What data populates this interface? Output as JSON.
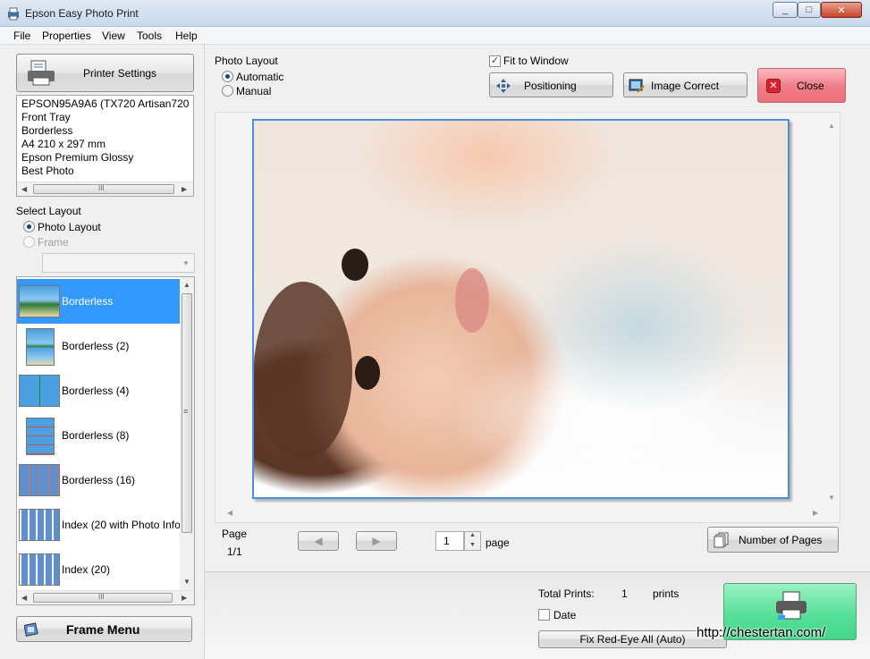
{
  "window": {
    "title": "Epson Easy Photo Print",
    "minimize": "_",
    "maximize": "□",
    "close": "✕"
  },
  "menu": [
    "File",
    "Properties",
    "View",
    "Tools",
    "Help"
  ],
  "printer": {
    "button_label": "Printer Settings",
    "info": [
      "EPSON95A9A6 (TX720 Artisan720",
      "Front Tray",
      "Borderless",
      "A4 210 x 297 mm",
      "Epson Premium Glossy",
      "Best Photo"
    ],
    "scroll_grip": "III"
  },
  "select_layout": {
    "heading": "Select Layout",
    "options": [
      "Photo Layout",
      "Frame"
    ],
    "selected": "Photo Layout",
    "items": [
      "Borderless",
      "Borderless (2)",
      "Borderless (4)",
      "Borderless (8)",
      "Borderless (16)",
      "Index (20 with Photo Info",
      "Index (20)"
    ],
    "selected_item": "Borderless",
    "scroll_grip_v": "≡",
    "scroll_grip_h": "III"
  },
  "frame_menu": {
    "label": "Frame Menu"
  },
  "photo_layout": {
    "heading": "Photo Layout",
    "options": [
      "Automatic",
      "Manual"
    ],
    "selected": "Automatic"
  },
  "toolbar": {
    "fit_to_window": "Fit to Window",
    "fit_checked": true,
    "positioning": "Positioning",
    "image_correct": "Image Correct",
    "close": "Close"
  },
  "pager": {
    "page_label": "Page",
    "page_value": "1/1",
    "page_input": "1",
    "page_suffix": "page",
    "number_of_pages": "Number of Pages"
  },
  "footer": {
    "total_prints_label": "Total Prints:",
    "total_prints_value": "1",
    "prints_unit": "prints",
    "date_label": "Date",
    "fix_red_eye": "Fix Red-Eye All (Auto)",
    "watermark": "http://chestertan.com/"
  },
  "colors": {
    "accent": "#3399ff",
    "close_button": "#f07c86",
    "print_button": "#58e09a"
  }
}
